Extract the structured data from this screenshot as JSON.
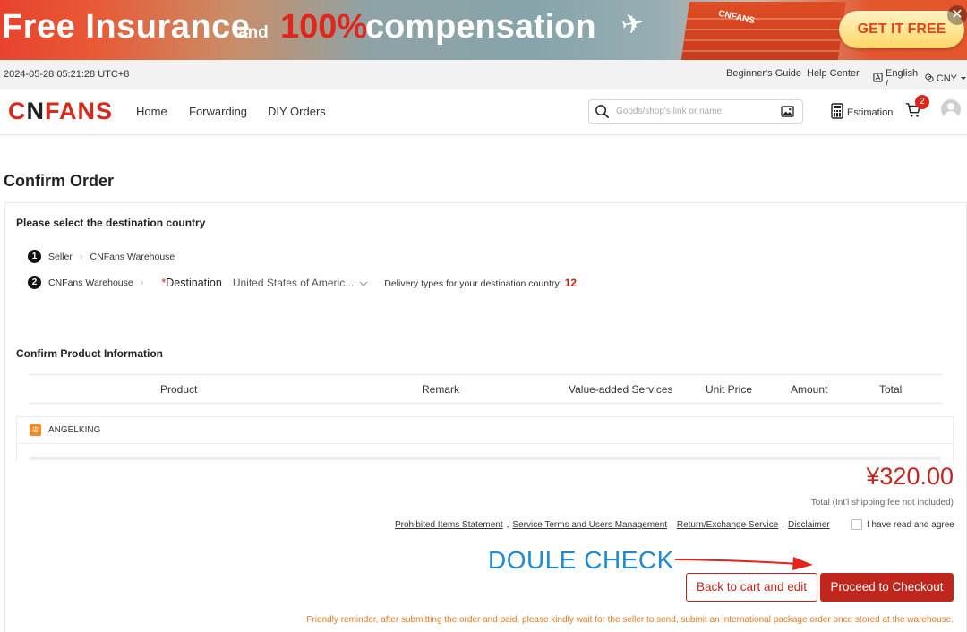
{
  "banner": {
    "free_insurance": "Free Insurance",
    "and": "and",
    "percent": "100%",
    "compensation": "compensation",
    "warehouse_label": "CNFANS",
    "cta": "GET IT FREE",
    "close": "✕"
  },
  "topbar": {
    "datetime": "2024-05-28 05:21:28 UTC+8",
    "guide": "Beginner's Guide",
    "help": "Help Center",
    "language": "English /",
    "currency": "CNY"
  },
  "header": {
    "logo_c": "C",
    "logo_n": "N",
    "logo_rest": "FANS",
    "nav": [
      "Home",
      "Forwarding",
      "DIY Orders"
    ],
    "search_placeholder": "Goods/shop's link or name",
    "estimation": "Estimation",
    "cart_count": "2"
  },
  "page": {
    "title": "Confirm Order",
    "destination_section": "Please select the destination country",
    "step1": {
      "num": "1",
      "from": "Seller",
      "to": "CNFans Warehouse"
    },
    "step2": {
      "num": "2",
      "from": "CNFans Warehouse",
      "required": "*",
      "dest_label": "Destination",
      "dest_value": "United States of Americ...",
      "delivery_text": "Delivery types for your destination country:",
      "delivery_count": "12"
    },
    "product_section": "Confirm Product Information",
    "columns": [
      "Product",
      "Remark",
      "Value-added Services",
      "Unit Price",
      "Amount",
      "Total"
    ],
    "shop": {
      "icon": "店",
      "name": "ANGELKING"
    },
    "total": "¥320.00",
    "total_note": "Total (Int'l shipping fee not included)",
    "links": [
      "Prohibited Items Statement",
      "Service Terms and Users Management",
      "Return/Exchange Service",
      "Disclaimer"
    ],
    "agree": "I have read and agree",
    "annotation": "DOULE CHECK",
    "back_button": "Back to cart and edit",
    "checkout_button": "Proceed to Checkout",
    "reminder": "Friendly reminder, after submitting the order and paid, please kindly wait for the seller to send, submit an international package order once stored at the warehouse."
  },
  "colors": {
    "brand_red": "#c0261c",
    "annotation_blue": "#1e8ad6",
    "reminder_orange": "#e07a20"
  },
  "icons": [
    "close-icon",
    "plane-icon",
    "globe-icon",
    "currency-icon",
    "chevron-down-icon",
    "search-icon",
    "image-search-icon",
    "calculator-icon",
    "cart-icon",
    "user-avatar-icon",
    "chevron-right-icon",
    "shop-icon",
    "arrow-icon"
  ]
}
